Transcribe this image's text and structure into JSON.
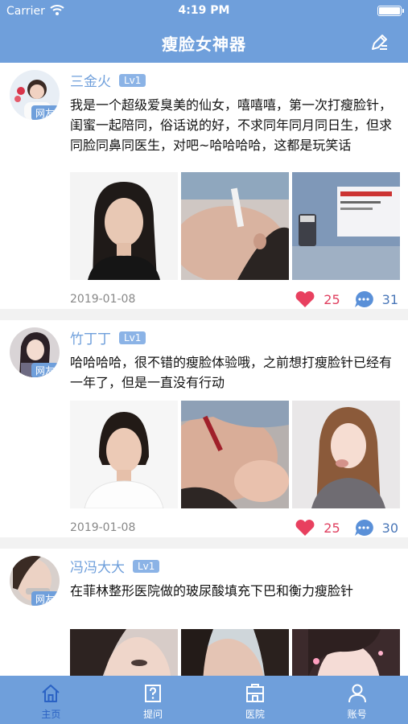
{
  "status_bar": {
    "carrier": "Carrier",
    "time": "4:19 PM"
  },
  "nav": {
    "title": "瘦脸女神器",
    "edit_icon": "edit-icon"
  },
  "posts": [
    {
      "username": "三金火",
      "level": "Lv1",
      "badge": "网友",
      "content": "我是一个超级爱臭美的仙女，嘻嘻嘻，第一次打瘦脸针，闺蜜一起陪同，俗话说的好，不求同年同月同日生，但求同脸同鼻同医生，对吧~哈哈哈哈，这都是玩笑话",
      "date": "2019-01-08",
      "likes": "25",
      "comments": "31"
    },
    {
      "username": "竹丁丁",
      "level": "Lv1",
      "badge": "网友",
      "content": "哈哈哈哈，很不错的瘦脸体验哦，之前想打瘦脸针已经有一年了，但是一直没有行动",
      "date": "2019-01-08",
      "likes": "25",
      "comments": "30"
    },
    {
      "username": "冯冯大大",
      "level": "Lv1",
      "badge": "网友",
      "content": "在菲林整形医院做的玻尿酸填充下巴和衡力瘦脸针"
    }
  ],
  "tabs": [
    {
      "label": "主页",
      "icon": "home-icon",
      "active": true
    },
    {
      "label": "提问",
      "icon": "question-icon",
      "active": false
    },
    {
      "label": "医院",
      "icon": "hospital-icon",
      "active": false
    },
    {
      "label": "账号",
      "icon": "account-icon",
      "active": false
    }
  ],
  "colors": {
    "primary": "#6f9fdb",
    "active_tab": "#2a62c4",
    "like": "#e04060",
    "comment": "#4a77b8"
  }
}
